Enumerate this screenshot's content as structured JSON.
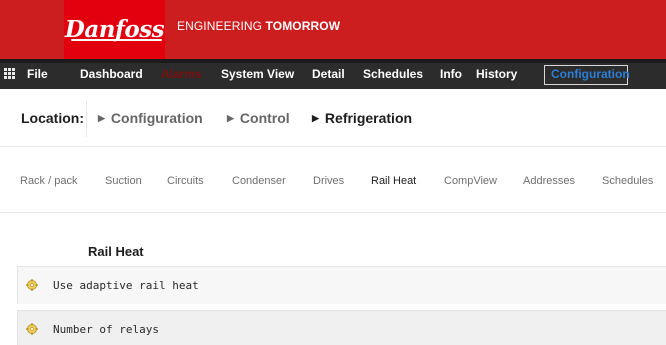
{
  "header": {
    "logo_text": "Danfoss",
    "tagline_prefix": "ENGINEERING ",
    "tagline_bold": "TOMORROW"
  },
  "menu": {
    "items": [
      {
        "label": "File"
      },
      {
        "label": "Dashboard"
      },
      {
        "label": "Alarms"
      },
      {
        "label": "System View"
      },
      {
        "label": "Detail"
      },
      {
        "label": "Schedules"
      },
      {
        "label": "Info"
      },
      {
        "label": "History"
      },
      {
        "label": "Configuration"
      }
    ],
    "active": "Configuration"
  },
  "breadcrumb": {
    "label": "Location:",
    "items": [
      {
        "label": "Configuration"
      },
      {
        "label": "Control"
      },
      {
        "label": "Refrigeration"
      }
    ]
  },
  "tabs": {
    "items": [
      {
        "label": "Rack / pack"
      },
      {
        "label": "Suction"
      },
      {
        "label": "Circuits"
      },
      {
        "label": "Condenser"
      },
      {
        "label": "Drives"
      },
      {
        "label": "Rail Heat"
      },
      {
        "label": "CompView"
      },
      {
        "label": "Addresses"
      },
      {
        "label": "Schedules"
      }
    ],
    "active": "Rail Heat"
  },
  "section": {
    "title": "Rail Heat",
    "params": [
      {
        "label": "Use adaptive rail heat"
      },
      {
        "label": "Number of relays"
      }
    ]
  },
  "colors": {
    "brand_red": "#e2000f",
    "header_red": "#cc1d1f",
    "menu_bg": "#2c2c2c",
    "active_menu": "#2b7fd6",
    "alarm_text": "#7a1010"
  },
  "icons": {
    "menu": "grid-menu-icon",
    "breadcrumb_arrow": "triangle-right-icon",
    "param": "gear-icon"
  }
}
